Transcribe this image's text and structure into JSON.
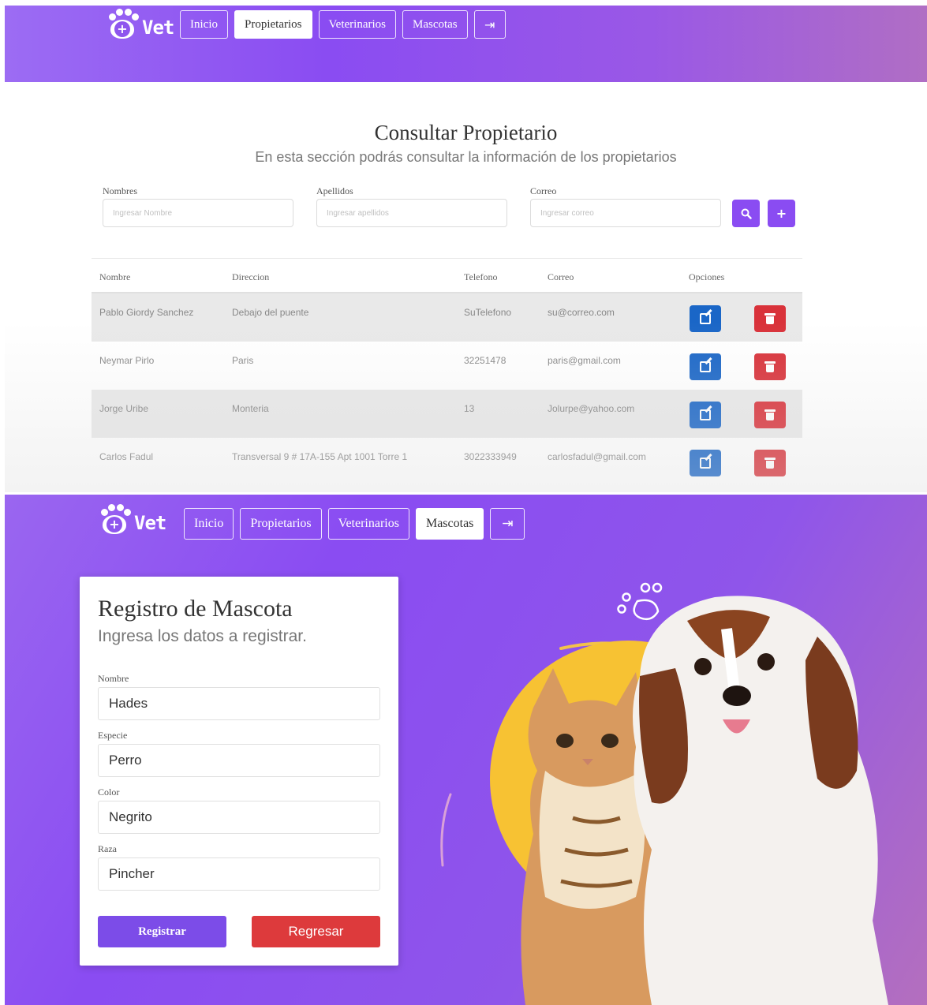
{
  "brand": {
    "name": "Vet"
  },
  "top": {
    "nav": [
      {
        "label": "Inicio",
        "active": false
      },
      {
        "label": "Propietarios",
        "active": true
      },
      {
        "label": "Veterinarios",
        "active": false
      },
      {
        "label": "Mascotas",
        "active": false
      }
    ],
    "nav_logout_icon": "logout-icon",
    "title": "Consultar Propietario",
    "subtitle": "En esta sección podrás consultar la información de los propietarios",
    "filters": {
      "nombres_label": "Nombres",
      "nombres_placeholder": "Ingresar Nombre",
      "apellidos_label": "Apellidos",
      "apellidos_placeholder": "Ingresar apellidos",
      "correo_label": "Correo",
      "correo_placeholder": "Ingresar correo",
      "search_icon": "search-icon",
      "add_label": "+"
    },
    "table": {
      "headers": [
        "Nombre",
        "Direccion",
        "Telefono",
        "Correo",
        "Opciones"
      ],
      "rows": [
        {
          "nombre": "Pablo Giordy Sanchez",
          "direccion": "Debajo del puente",
          "telefono": "SuTelefono",
          "correo": "su@correo.com"
        },
        {
          "nombre": "Neymar Pirlo",
          "direccion": "Paris",
          "telefono": "32251478",
          "correo": "paris@gmail.com"
        },
        {
          "nombre": "Jorge Uribe",
          "direccion": "Monteria",
          "telefono": "13",
          "correo": "Jolurpe@yahoo.com"
        },
        {
          "nombre": "Carlos Fadul",
          "direccion": "Transversal 9 # 17A-155 Apt 1001 Torre 1",
          "telefono": "3022333949",
          "correo": "carlosfadul@gmail.com"
        }
      ]
    }
  },
  "bottom": {
    "nav": [
      {
        "label": "Inicio",
        "active": false
      },
      {
        "label": "Propietarios",
        "active": false
      },
      {
        "label": "Veterinarios",
        "active": false
      },
      {
        "label": "Mascotas",
        "active": true
      }
    ],
    "card": {
      "title": "Registro de Mascota",
      "subtitle": "Ingresa los datos a registrar.",
      "fields": [
        {
          "label": "Nombre",
          "value": "Hades"
        },
        {
          "label": "Especie",
          "value": "Perro"
        },
        {
          "label": "Color",
          "value": "Negrito"
        },
        {
          "label": "Raza",
          "value": "Pincher"
        }
      ],
      "register_label": "Registrar",
      "back_label": "Regresar"
    }
  },
  "colors": {
    "primary": "#8a4cf2",
    "edit": "#1a66c7",
    "delete": "#d9323a",
    "accent_yellow": "#f7c233"
  }
}
